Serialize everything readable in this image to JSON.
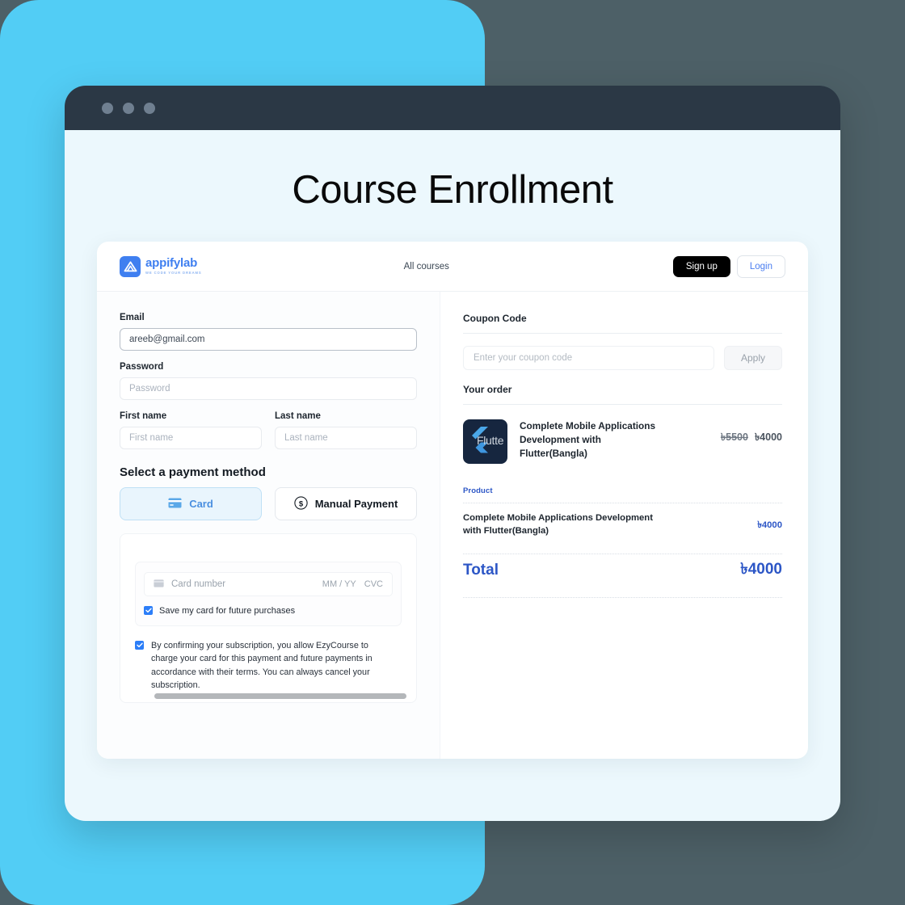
{
  "page": {
    "title": "Course Enrollment"
  },
  "browser": {
    "dots": [
      "dot-1",
      "dot-2",
      "dot-3"
    ]
  },
  "app": {
    "header": {
      "logo_word": "appifylab",
      "logo_tagline": "WE CODE YOUR DREAMS",
      "nav_link": "All courses",
      "signup_label": "Sign up",
      "login_label": "Login"
    },
    "form": {
      "email_label": "Email",
      "email_value": "areeb@gmail.com",
      "password_label": "Password",
      "password_placeholder": "Password",
      "first_name_label": "First name",
      "first_name_placeholder": "First name",
      "last_name_label": "Last name",
      "last_name_placeholder": "Last name",
      "payment_section_title": "Select a payment method",
      "method_card": "Card",
      "method_manual": "Manual Payment",
      "card_number_placeholder": "Card number",
      "card_expiry": "MM / YY",
      "card_cvc": "CVC",
      "save_card_label": "Save my card for future purchases",
      "consent_text": "By confirming your subscription, you allow EzyCourse to charge your card for this payment and future payments in accordance with their terms. You can always cancel your subscription."
    },
    "order": {
      "coupon_label": "Coupon Code",
      "coupon_placeholder": "Enter your coupon code",
      "apply_label": "Apply",
      "your_order_label": "Your order",
      "item": {
        "thumb_text": "Flutte",
        "name": "Complete Mobile Applications Development with Flutter(Bangla)",
        "price_old": "৳5500",
        "price_new": "৳4000"
      },
      "product_tag": "Product",
      "line_item_name": "Complete Mobile Applications Development with Flutter(Bangla)",
      "line_item_value": "৳4000",
      "total_label": "Total",
      "total_value": "৳4000"
    }
  },
  "colors": {
    "backdrop_slate": "#4d6067",
    "backdrop_cyan": "#52cdf5",
    "browser_bar": "#2b3845",
    "browser_body": "#ecf8fd",
    "brand_blue": "#3f7ff0",
    "accent_blue": "#2c56c6",
    "signup_black": "#000000"
  }
}
